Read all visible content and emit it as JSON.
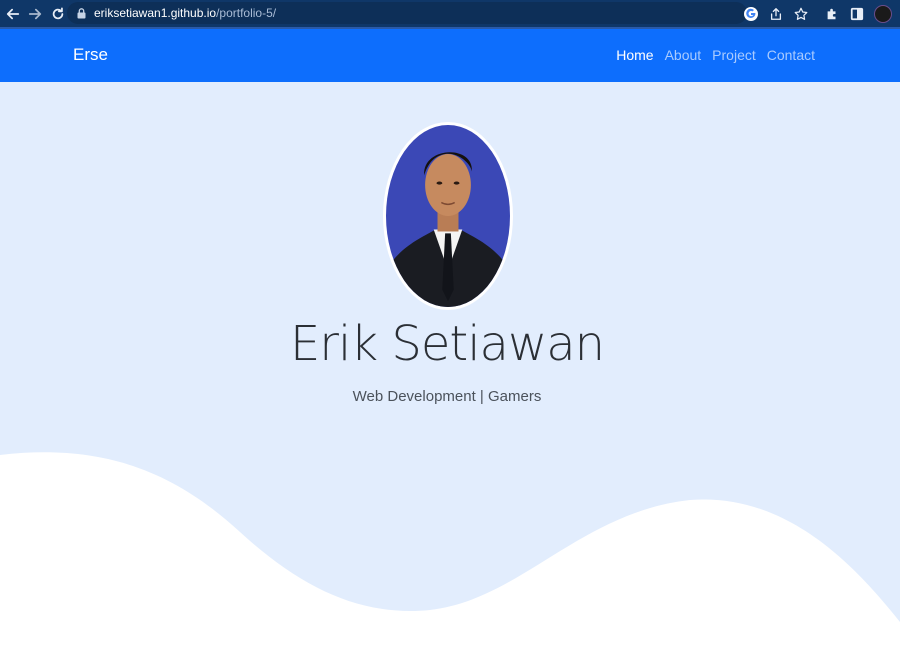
{
  "browser": {
    "url_host": "eriksetiawan1.github.io",
    "url_path": "/portfolio-5/",
    "icons": [
      "back-arrow-icon",
      "forward-arrow-icon",
      "reload-icon",
      "lock-icon",
      "google-icon",
      "share-icon",
      "star-icon",
      "extensions-icon",
      "side-panel-icon",
      "profile-avatar"
    ]
  },
  "navbar": {
    "brand": "Erse",
    "links": [
      {
        "label": "Home",
        "active": true
      },
      {
        "label": "About",
        "active": false
      },
      {
        "label": "Project",
        "active": false
      },
      {
        "label": "Contact",
        "active": false
      }
    ],
    "background": "#0d6efd"
  },
  "hero": {
    "name": "Erik Setiawan",
    "subtitle": "Web Development | Gamers",
    "background": "#e2edfd"
  }
}
